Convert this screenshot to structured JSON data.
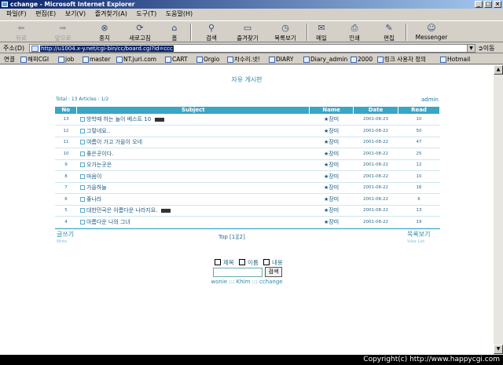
{
  "window": {
    "title": "cchange - Microsoft Internet Explorer"
  },
  "menu": [
    "파일(F)",
    "편집(E)",
    "보기(V)",
    "즐겨찾기(A)",
    "도구(T)",
    "도움말(H)"
  ],
  "toolbar": {
    "back": "뒤로",
    "forward": "앞으로",
    "stop": "중지",
    "refresh": "새로고침",
    "home": "홈",
    "search": "검색",
    "favorites": "즐겨찾기",
    "history": "목록보기",
    "mail": "메일",
    "print": "인쇄",
    "edit": "편집",
    "messenger": "Messenger"
  },
  "address": {
    "label": "주소(D)",
    "url": "http://u1004.x-y.net/cgi-bin/cc/board.cgi?id=ccc",
    "go": "이동"
  },
  "links": {
    "label": "연결",
    "items": [
      "해피CGI",
      "job",
      "master",
      "NT.juri.com",
      "CART",
      "Orgio",
      "차수리.넷!",
      "DIARY",
      "Diary_admin",
      "2000",
      "링크 사용자 정의",
      "Hotmail"
    ]
  },
  "board": {
    "title": "자유 게시판",
    "total": "Total : 13 Articles : 1/2",
    "admin": "admin",
    "headers": {
      "no": "No",
      "subject": "Subject",
      "name": "Name",
      "date": "Date",
      "read": "Read"
    },
    "rows": [
      {
        "no": "13",
        "subject": "방학때 하는 놀이 베스트 10",
        "name": "★장미",
        "date": "2001-08-23",
        "read": "10",
        "is_new": true
      },
      {
        "no": "12",
        "subject": "그렇네요..",
        "name": "★장미",
        "date": "2001-08-22",
        "read": "50",
        "is_new": false
      },
      {
        "no": "11",
        "subject": "여름이 가고 가을이 오네",
        "name": "★장미",
        "date": "2001-08-22",
        "read": "47",
        "is_new": false
      },
      {
        "no": "10",
        "subject": "좋은곳이다.",
        "name": "★장미",
        "date": "2001-08-22",
        "read": "25",
        "is_new": false
      },
      {
        "no": "9",
        "subject": "오가는곳은",
        "name": "★장미",
        "date": "2001-08-22",
        "read": "12",
        "is_new": false
      },
      {
        "no": "8",
        "subject": "마음이",
        "name": "★장미",
        "date": "2001-08-22",
        "read": "10",
        "is_new": false
      },
      {
        "no": "7",
        "subject": "가을하늘",
        "name": "★장미",
        "date": "2001-08-22",
        "read": "16",
        "is_new": false
      },
      {
        "no": "6",
        "subject": "좋나라",
        "name": "★장미",
        "date": "2001-08-22",
        "read": "6",
        "is_new": false
      },
      {
        "no": "5",
        "subject": "대한민국은 아름다운 나라지요.",
        "name": "★장미",
        "date": "2001-08-22",
        "read": "13",
        "is_new": true
      },
      {
        "no": "4",
        "subject": "아름다운 나의 그녀",
        "name": "★장미",
        "date": "2001-08-22",
        "read": "19",
        "is_new": false
      }
    ],
    "write_label": "글쓰기",
    "write_sub": "Write",
    "view_list_label": "목록보기",
    "view_list_sub": "View List",
    "pages": "Top  [1][2]",
    "search": {
      "check_subject": "제목",
      "check_name": "이름",
      "check_content": "내용",
      "button": "검색",
      "value": ""
    },
    "credits": "wonie ::: Khim ::: cchange"
  },
  "copyright": "Copyright(c) http://www.happycgi.com"
}
